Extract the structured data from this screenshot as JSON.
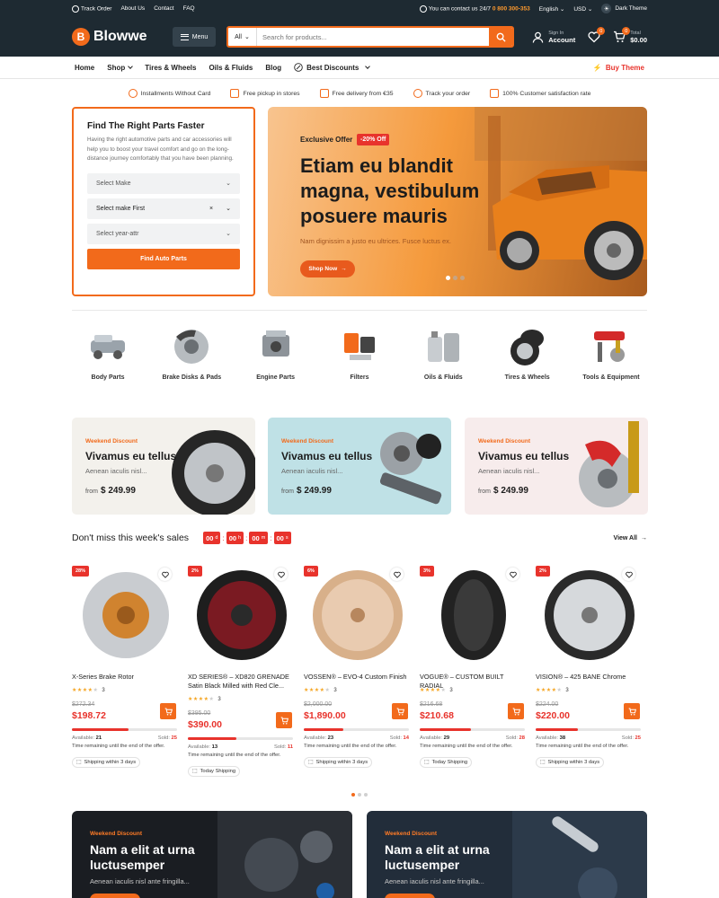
{
  "topbar": {
    "links": [
      "Track Order",
      "About Us",
      "Contact",
      "FAQ"
    ],
    "contact_text": "You can contact us 24/7",
    "phone": "0 800 300-353",
    "language": "English",
    "currency": "USD",
    "theme_label": "Dark Theme"
  },
  "header": {
    "logo": "Blowwe",
    "menu_label": "Menu",
    "search_category": "All",
    "search_placeholder": "Search for products...",
    "account_small": "Sign In",
    "account_big": "Account",
    "wishlist_count": "0",
    "cart_count": "0",
    "cart_small": "Total",
    "cart_total": "$0.00"
  },
  "nav": {
    "items": [
      "Home",
      "Shop",
      "Tires & Wheels",
      "Oils & Fluids",
      "Blog",
      "Best Discounts"
    ],
    "buy_theme": "Buy Theme"
  },
  "features": [
    "Installments Without Card",
    "Free pickup in stores",
    "Free delivery from €35",
    "Track your order",
    "100% Customer satisfaction rate"
  ],
  "finder": {
    "title": "Find The Right Parts Faster",
    "desc": "Having the right automotive parts and car accessories will help you to boost your travel comfort and go on the long-distance journey comfortably that you have been planning.",
    "select1": "Select Make",
    "select2": "Select make First",
    "select3": "Select year-attr",
    "button": "Find Auto Parts"
  },
  "hero": {
    "offer": "Exclusive Offer",
    "discount": "-20% Off",
    "title": "Etiam eu blandit magna, vestibulum posuere mauris",
    "subtitle": "Nam dignissim a justo eu ultrices. Fusce luctus ex.",
    "button": "Shop Now",
    "slides": 3,
    "active_slide": 1
  },
  "categories": [
    {
      "label": "Body Parts",
      "icon": "body-parts-icon"
    },
    {
      "label": "Brake Disks & Pads",
      "icon": "brake-disk-icon"
    },
    {
      "label": "Engine Parts",
      "icon": "engine-icon"
    },
    {
      "label": "Filters",
      "icon": "filter-icon"
    },
    {
      "label": "Oils & Fluids",
      "icon": "oil-can-icon"
    },
    {
      "label": "Tires & Wheels",
      "icon": "tire-icon"
    },
    {
      "label": "Tools & Equipment",
      "icon": "tools-icon"
    }
  ],
  "promos": [
    {
      "tag": "Weekend Discount",
      "title": "Vivamus eu tellus",
      "desc": "Aenean iaculis nisl...",
      "from": "from",
      "price": "$ 249.99",
      "bg": "#f3f1ec"
    },
    {
      "tag": "Weekend Discount",
      "title": "Vivamus eu tellus",
      "desc": "Aenean iaculis nisl...",
      "from": "from",
      "price": "$ 249.99",
      "bg": "#bfe1e6"
    },
    {
      "tag": "Weekend Discount",
      "title": "Vivamus eu tellus",
      "desc": "Aenean iaculis nisl...",
      "from": "from",
      "price": "$ 249.99",
      "bg": "#f7ecec"
    }
  ],
  "sales": {
    "title": "Don't miss this week's sales",
    "countdown": [
      {
        "v": "00",
        "u": "d"
      },
      {
        "v": "00",
        "u": "h"
      },
      {
        "v": "00",
        "u": "m"
      },
      {
        "v": "00",
        "u": "s"
      }
    ],
    "view_all": "View All"
  },
  "products": [
    {
      "discount": "28%",
      "name": "X-Series Brake Rotor",
      "rating": 3,
      "old": "$272.34",
      "price": "$198.72",
      "available": "21",
      "sold": "25",
      "progress": 0.54,
      "remaining": "Time remaining until the end of the offer.",
      "ship": "Shipping within 3 days"
    },
    {
      "discount": "2%",
      "name": "XD SERIES® – XD820 GRENADE Satin Black Milled with Red Cle...",
      "rating": 3,
      "old": "$395.00",
      "price": "$390.00",
      "available": "13",
      "sold": "11",
      "progress": 0.46,
      "remaining": "Time remaining until the end of the offer.",
      "ship": "Today Shipping"
    },
    {
      "discount": "6%",
      "name": "VOSSEN® – EVO-4 Custom Finish",
      "rating": 3,
      "old": "$2,000.00",
      "price": "$1,890.00",
      "available": "23",
      "sold": "14",
      "progress": 0.38,
      "remaining": "Time remaining until the end of the offer.",
      "ship": "Shipping within 3 days"
    },
    {
      "discount": "3%",
      "name": "VOGUE® – CUSTOM BUILT RADIAL",
      "rating": 3,
      "old": "$216.68",
      "price": "$210.68",
      "available": "29",
      "sold": "28",
      "progress": 0.49,
      "remaining": "Time remaining until the end of the offer.",
      "ship": "Today Shipping"
    },
    {
      "discount": "2%",
      "name": "VISION® – 425 BANE Chrome",
      "rating": 3,
      "old": "$224.00",
      "price": "$220.00",
      "available": "38",
      "sold": "25",
      "progress": 0.4,
      "remaining": "Time remaining until the end of the offer.",
      "ship": "Shipping within 3 days"
    }
  ],
  "bottom_banners": [
    {
      "tag": "Weekend Discount",
      "title": "Nam a elit at urna luctusemper",
      "desc": "Aenean iaculis nisl ante fringilla..."
    },
    {
      "tag": "Weekend Discount",
      "title": "Nam a elit at urna luctusemper",
      "desc": "Aenean iaculis nisl ante fringilla..."
    }
  ],
  "colors": {
    "accent": "#f26a1b",
    "sale": "#e8332c",
    "header": "#1e2a32"
  }
}
